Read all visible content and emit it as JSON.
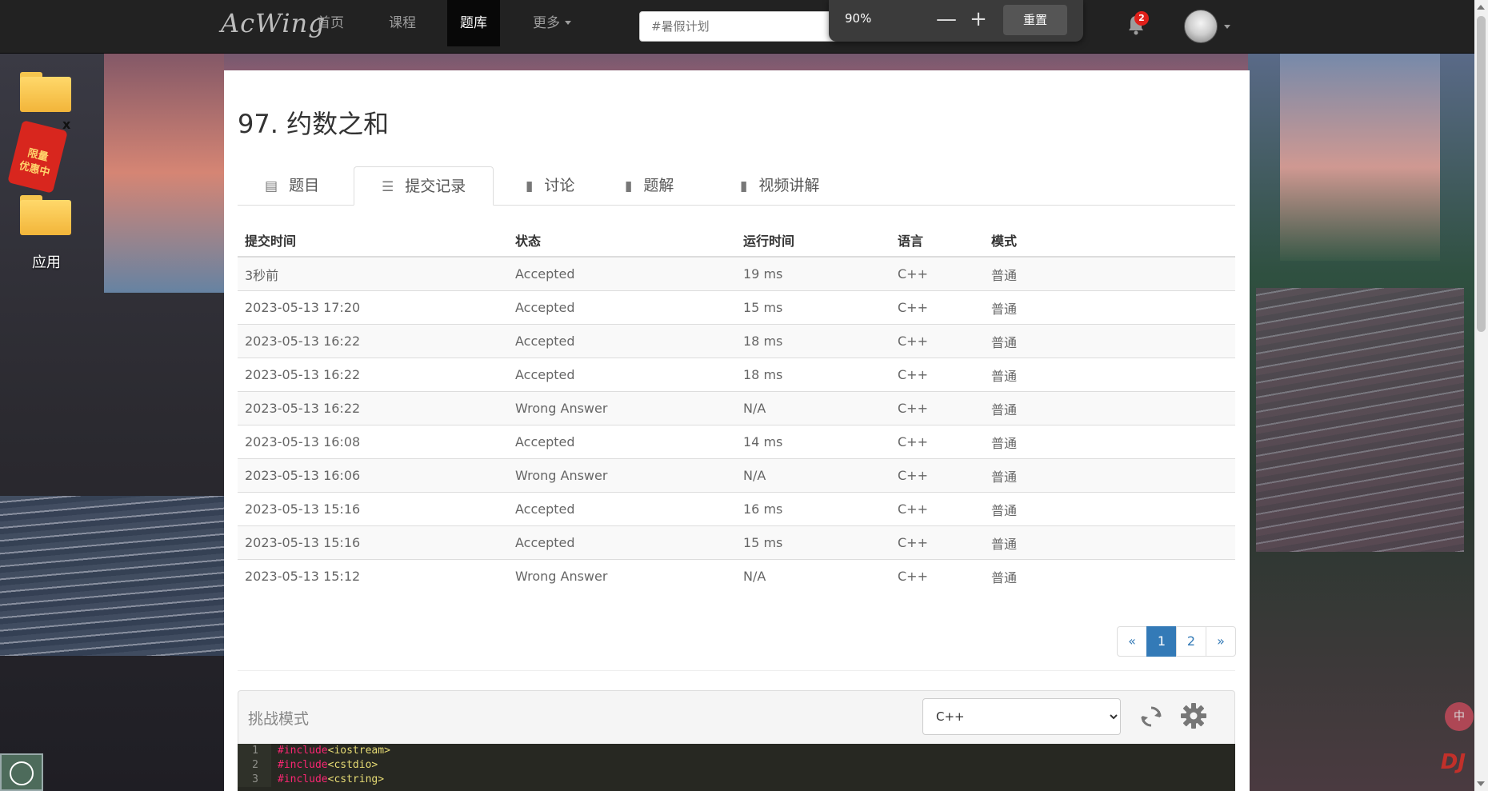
{
  "nav": {
    "brand": "AcWing",
    "items": [
      "首页",
      "课程",
      "题库",
      "更多"
    ],
    "active_index": 2,
    "search_placeholder": "#暑假计划",
    "notification_count": "2"
  },
  "zoom_popup": {
    "level": "90%",
    "minus": "—",
    "plus": "+",
    "reset": "重置"
  },
  "desktop": {
    "folder_label": "应用",
    "red_envelope_text": "限量\n优惠中",
    "close": "x"
  },
  "problem": {
    "title": "97. 约数之和"
  },
  "tabs": [
    {
      "icon": "list-icon",
      "label": "题目"
    },
    {
      "icon": "list-icon",
      "label": "提交记录"
    },
    {
      "icon": "comment-icon",
      "label": "讨论"
    },
    {
      "icon": "book-icon",
      "label": "题解"
    },
    {
      "icon": "book-icon",
      "label": "视频讲解"
    }
  ],
  "active_tab": 1,
  "table": {
    "headers": [
      "提交时间",
      "状态",
      "运行时间",
      "语言",
      "模式"
    ],
    "rows": [
      [
        "3秒前",
        "Accepted",
        "19 ms",
        "C++",
        "普通"
      ],
      [
        "2023-05-13 17:20",
        "Accepted",
        "15 ms",
        "C++",
        "普通"
      ],
      [
        "2023-05-13 16:22",
        "Accepted",
        "18 ms",
        "C++",
        "普通"
      ],
      [
        "2023-05-13 16:22",
        "Accepted",
        "18 ms",
        "C++",
        "普通"
      ],
      [
        "2023-05-13 16:22",
        "Wrong Answer",
        "N/A",
        "C++",
        "普通"
      ],
      [
        "2023-05-13 16:08",
        "Accepted",
        "14 ms",
        "C++",
        "普通"
      ],
      [
        "2023-05-13 16:06",
        "Wrong Answer",
        "N/A",
        "C++",
        "普通"
      ],
      [
        "2023-05-13 15:16",
        "Accepted",
        "16 ms",
        "C++",
        "普通"
      ],
      [
        "2023-05-13 15:16",
        "Accepted",
        "15 ms",
        "C++",
        "普通"
      ],
      [
        "2023-05-13 15:12",
        "Wrong Answer",
        "N/A",
        "C++",
        "普通"
      ]
    ]
  },
  "pagination": {
    "prev": "«",
    "pages": [
      "1",
      "2"
    ],
    "current": "1",
    "next": "»"
  },
  "editor": {
    "mode_label": "挑战模式",
    "language": "C++",
    "language_options": [
      "C++"
    ],
    "code_lines": [
      {
        "n": "1",
        "directive": "#include",
        "header": "<iostream>"
      },
      {
        "n": "2",
        "directive": "#include",
        "header": "<cstdio>"
      },
      {
        "n": "3",
        "directive": "#include",
        "header": "<cstring>"
      }
    ]
  },
  "colors": {
    "accepted": "#3c9a3c",
    "wrong_answer": "#a94442",
    "primary": "#337ab7",
    "navbar": "#222222"
  },
  "side_widget": {
    "badge_text": "中",
    "logo_text": "DJ"
  }
}
